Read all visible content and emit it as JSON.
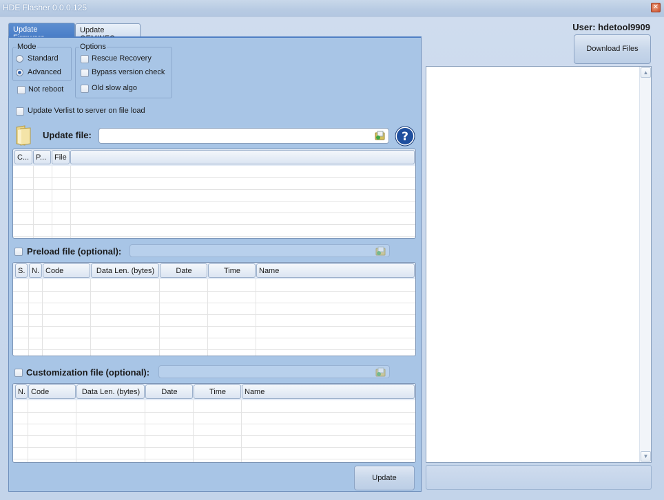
{
  "window": {
    "title": "HDE Flasher 0.0.0.125",
    "close_glyph": "✕"
  },
  "tabs": [
    {
      "label": "Update Firmware",
      "active": true
    },
    {
      "label": "Update OEMINFO",
      "active": false
    }
  ],
  "mode": {
    "label": "Mode",
    "options": [
      {
        "label": "Standard",
        "checked": false
      },
      {
        "label": "Advanced",
        "checked": true
      }
    ],
    "not_reboot": {
      "label": "Not reboot",
      "checked": false
    }
  },
  "options": {
    "label": "Options",
    "items": [
      {
        "label": "Rescue Recovery",
        "checked": false
      },
      {
        "label": "Bypass version check",
        "checked": false
      },
      {
        "label": "Old slow algo",
        "checked": false
      }
    ]
  },
  "verlist": {
    "label": "Update Verlist to server on file load",
    "checked": false
  },
  "update_file": {
    "label": "Update file:",
    "value": "",
    "help_glyph": "?",
    "columns": [
      "C...",
      "P...",
      "File",
      ""
    ]
  },
  "preload": {
    "label": "Preload file (optional):",
    "checked": false,
    "value": "",
    "columns": [
      "S.",
      "N.",
      "Code",
      "Data Len. (bytes)",
      "Date",
      "Time",
      "Name"
    ]
  },
  "customization": {
    "label": "Customization file (optional):",
    "checked": false,
    "value": "",
    "columns": [
      "N.",
      "Code",
      "Data Len. (bytes)",
      "Date",
      "Time",
      "Name"
    ]
  },
  "buttons": {
    "update": "Update",
    "download": "Download Files"
  },
  "user": {
    "label": "User: hdetool9909"
  },
  "log": {
    "text": ""
  },
  "status": {
    "text": ""
  },
  "icons": {
    "folder": "folder-icon",
    "browse": "browse-folder-icon",
    "help": "help-icon",
    "scroll_up": "▲",
    "scroll_down": "▼"
  }
}
